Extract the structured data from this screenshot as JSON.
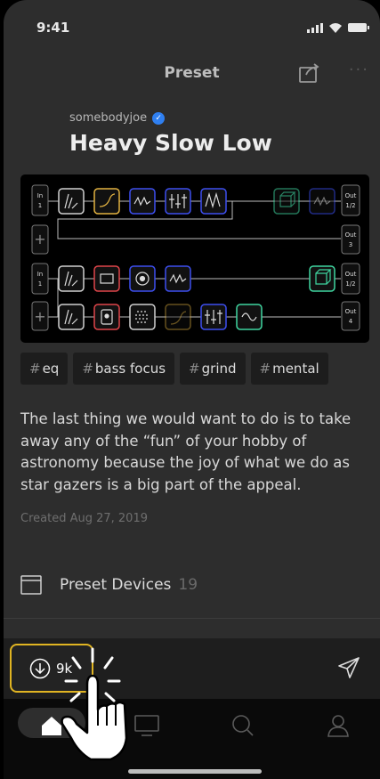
{
  "status": {
    "time": "9:41"
  },
  "navbar": {
    "title": "Preset"
  },
  "preset": {
    "author": "somebodyjoe",
    "title": "Heavy Slow Low",
    "tags": [
      "eq",
      "bass focus",
      "grind",
      "mental"
    ],
    "description": "The last thing we would want to do is to take away any of the “fun” of your hobby of astronomy because the joy of what we do as star gazers is a big part of the appeal.",
    "created": "Created Aug 27, 2019"
  },
  "devices": {
    "label": "Preset Devices",
    "count": "19"
  },
  "action_bar": {
    "download_count": "9k"
  },
  "chain": {
    "rows": [
      {
        "input": [
          "In",
          "1"
        ],
        "output": [
          "Out",
          "1/2"
        ]
      },
      {
        "input": [
          "+"
        ],
        "output": [
          "Out",
          "3"
        ]
      },
      {
        "input": [
          "In",
          "1"
        ],
        "output": [
          "Out",
          "1/2"
        ]
      },
      {
        "input": [
          "+"
        ],
        "output": [
          "Out",
          "4"
        ]
      }
    ]
  },
  "colors": {
    "accent": "#e0b422",
    "verified": "#2f7ff0",
    "device_yellow": "#e3b341",
    "device_blue": "#3d4ff0",
    "device_red": "#e0454a",
    "device_green": "#3fd6a0",
    "device_white": "#cfcfcf"
  },
  "icons": [
    "signal-icon",
    "wifi-icon",
    "battery-icon",
    "share-icon",
    "more-icon",
    "verified-icon",
    "download-icon",
    "send-icon",
    "home-icon",
    "devices-icon",
    "search-icon",
    "profile-icon",
    "device-folder-icon"
  ]
}
